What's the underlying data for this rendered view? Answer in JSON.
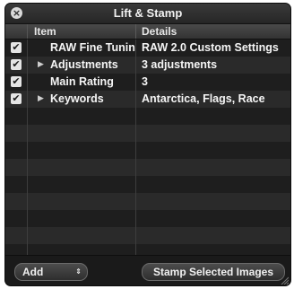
{
  "window": {
    "title": "Lift & Stamp",
    "close_icon": "close-icon"
  },
  "table": {
    "columns": [
      "Item",
      "Details"
    ],
    "rows": [
      {
        "checked": true,
        "expandable": false,
        "item": "RAW Fine Tunin",
        "details": "RAW 2.0 Custom Settings"
      },
      {
        "checked": true,
        "expandable": true,
        "item": "Adjustments",
        "details": "3 adjustments"
      },
      {
        "checked": true,
        "expandable": false,
        "item": "Main Rating",
        "details": "3"
      },
      {
        "checked": true,
        "expandable": true,
        "item": "Keywords",
        "details": "Antarctica, Flags, Race"
      }
    ]
  },
  "footer": {
    "add_label": "Add",
    "stamp_label": "Stamp Selected Images"
  }
}
